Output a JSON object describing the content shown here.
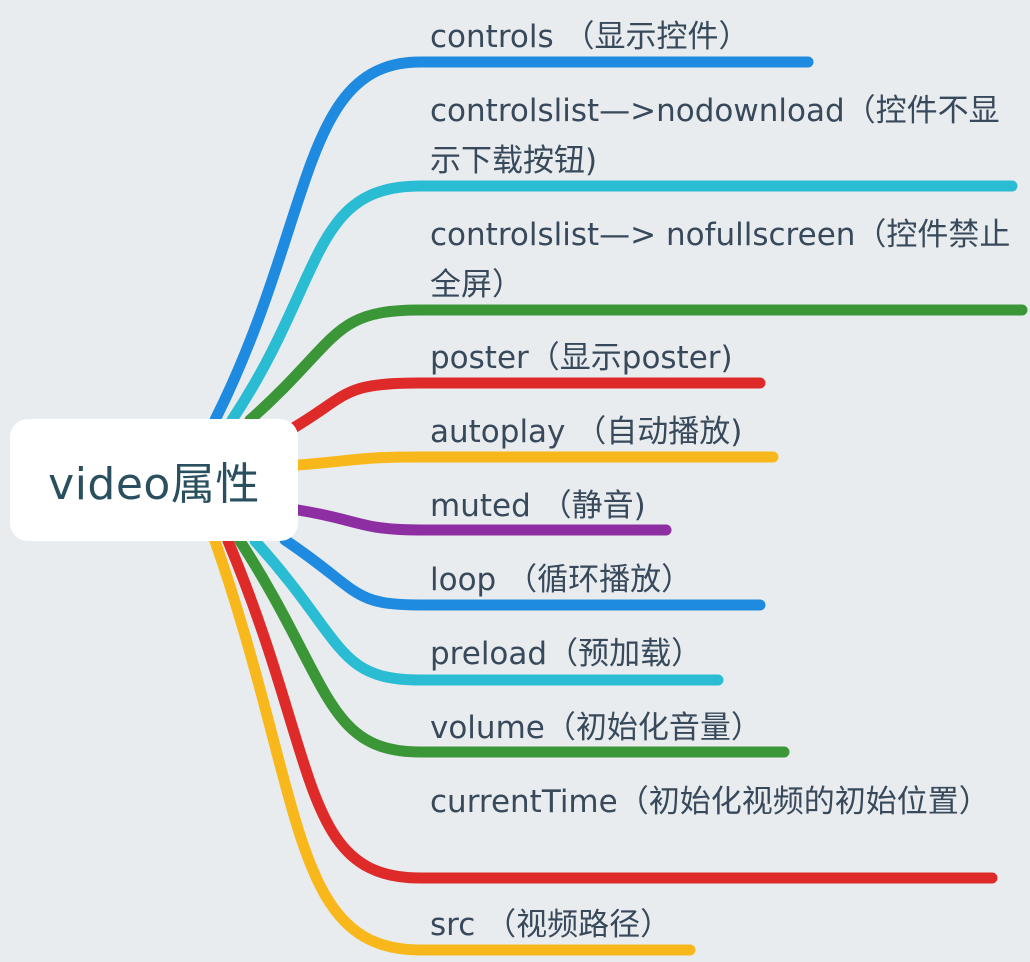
{
  "root": {
    "label": "video属性"
  },
  "branches": [
    {
      "label": "controls （显示控件）",
      "color": "#1e8be0"
    },
    {
      "label": "controlslist—>nodownload（控件不显示下载按钮)",
      "color": "#2abcd3"
    },
    {
      "label": "controlslist—> nofullscreen（控件禁止全屏）",
      "color": "#3b9637"
    },
    {
      "label": "poster（显示poster)",
      "color": "#df2a2a"
    },
    {
      "label": "autoplay （自动播放)",
      "color": "#f8b81b"
    },
    {
      "label": "muted （静音)",
      "color": "#8d2fa3"
    },
    {
      "label": "loop （循环播放）",
      "color": "#1e8be0"
    },
    {
      "label": "preload（预加载）",
      "color": "#2abcd3"
    },
    {
      "label": "volume（初始化音量）",
      "color": "#3b9637"
    },
    {
      "label": "currentTime（初始化视频的初始位置）",
      "color": "#df2a2a"
    },
    {
      "label": "src （视频路径）",
      "color": "#f8b81b"
    }
  ]
}
